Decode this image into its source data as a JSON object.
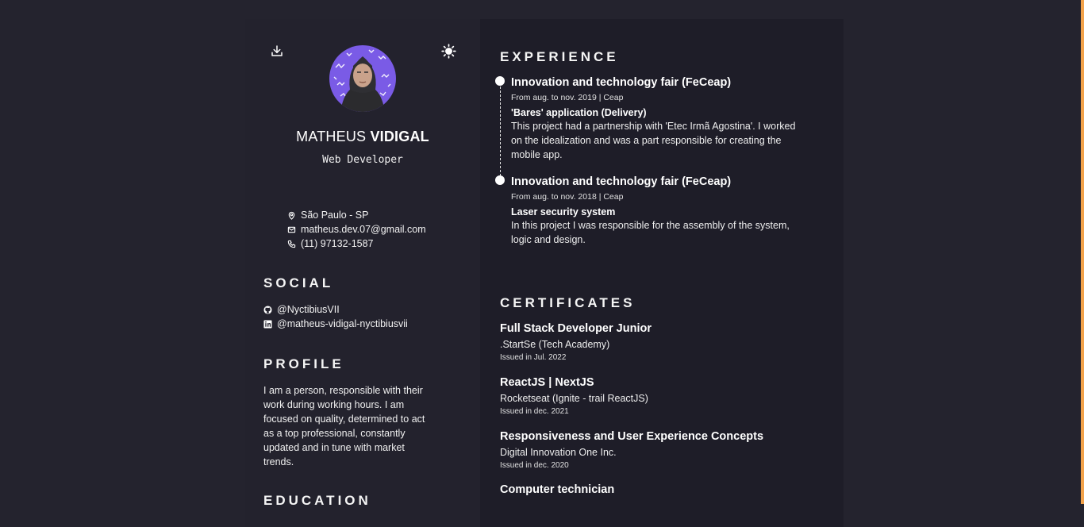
{
  "header": {
    "name_first": "MATHEUS",
    "name_last": "VIDIGAL",
    "job": "Web Developer"
  },
  "icons": {
    "download": "download-icon",
    "theme": "sun-icon",
    "location": "location-pin-icon",
    "email": "mail-icon",
    "phone": "phone-icon",
    "github": "github-icon",
    "linkedin": "linkedin-icon"
  },
  "contact": {
    "location": "São Paulo - SP",
    "email": "matheus.dev.07@gmail.com",
    "phone": "(11) 97132-1587"
  },
  "social": {
    "title": "SOCIAL",
    "github": "@NyctibiusVII",
    "linkedin": "@matheus-vidigal-nyctibiusvii"
  },
  "profile": {
    "title": "PROFILE",
    "text": "I am a person, responsible with their work during working hours. I am focused on quality, determined to act as a top professional, constantly updated and in tune with market trends."
  },
  "education": {
    "title": "EDUCATION"
  },
  "experience": {
    "title": "EXPERIENCE",
    "items": [
      {
        "title": "Innovation and technology fair (FeCeap)",
        "date": "From aug. to nov. 2019 | Ceap",
        "project": "'Bares' application (Delivery)",
        "desc": "This project had a partnership with 'Etec Irmã Agostina'. I worked on the idealization and was a part responsible for creating the mobile app."
      },
      {
        "title": "Innovation and technology fair (FeCeap)",
        "date": "From aug. to nov. 2018 | Ceap",
        "project": "Laser security system",
        "desc": "In this project I was responsible for the assembly of the system, logic and design."
      }
    ]
  },
  "certificates": {
    "title": "CERTIFICATES",
    "items": [
      {
        "title": "Full Stack Developer Junior",
        "org": ".StartSe (Tech Academy)",
        "date": "Issued in Jul. 2022"
      },
      {
        "title": "ReactJS | NextJS",
        "org": "Rocketseat (Ignite - trail ReactJS)",
        "date": "Issued in dec. 2021"
      },
      {
        "title": "Responsiveness and User Experience Concepts",
        "org": "Digital Innovation One Inc.",
        "date": "Issued in dec. 2020"
      },
      {
        "title": "Computer technician",
        "org": "",
        "date": ""
      }
    ]
  },
  "colors": {
    "background": "#24232e",
    "sidebar": "#23222d",
    "avatar_bg": "#7a5be6",
    "scrollbar": "#f2a24a"
  }
}
